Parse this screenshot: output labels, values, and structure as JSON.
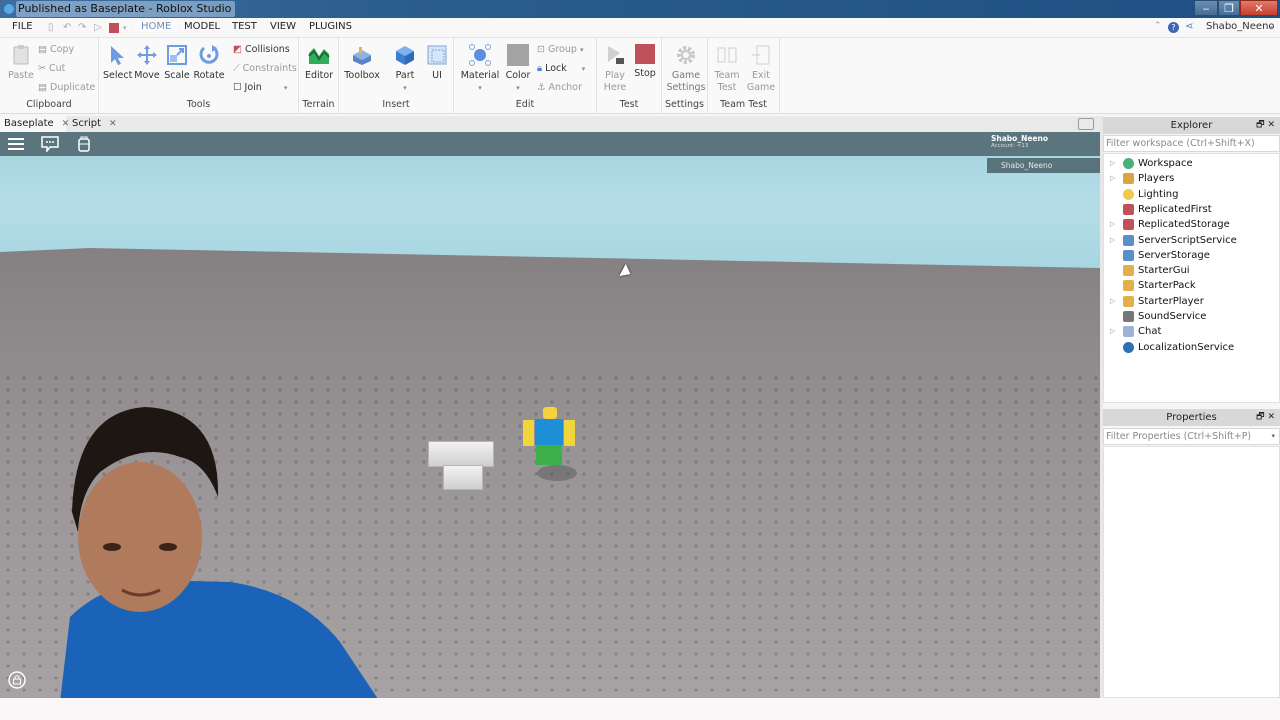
{
  "window": {
    "title": "Published as Baseplate - Roblox Studio",
    "controls": {
      "minimize": "‒",
      "maximize": "❐",
      "close": "✕"
    }
  },
  "menu": {
    "file": "FILE",
    "tabs": [
      "HOME",
      "MODEL",
      "TEST",
      "VIEW",
      "PLUGINS"
    ],
    "active_tab": "HOME",
    "username": "Shabo_Neeno",
    "user_dropdown": "▾"
  },
  "ribbon": {
    "clipboard": {
      "label": "Clipboard",
      "paste": "Paste",
      "copy": "Copy",
      "cut": "Cut",
      "duplicate": "Duplicate"
    },
    "tools": {
      "label": "Tools",
      "select": "Select",
      "move": "Move",
      "scale": "Scale",
      "rotate": "Rotate",
      "collisions": "Collisions",
      "constraints": "Constraints",
      "join": "Join"
    },
    "terrain": {
      "label": "Terrain",
      "editor": "Editor"
    },
    "insert": {
      "label": "Insert",
      "toolbox": "Toolbox",
      "part": "Part",
      "ui": "UI"
    },
    "edit": {
      "label": "Edit",
      "material": "Material",
      "color": "Color",
      "group": "Group",
      "lock": "Lock",
      "anchor": "Anchor"
    },
    "test": {
      "label": "Test",
      "play_here_1": "Play",
      "play_here_2": "Here",
      "stop": "Stop"
    },
    "settings": {
      "label": "Settings",
      "game_settings_1": "Game",
      "game_settings_2": "Settings"
    },
    "team_test": {
      "label": "Team Test",
      "team_test_1": "Team",
      "team_test_2": "Test",
      "exit_game_1": "Exit",
      "exit_game_2": "Game"
    }
  },
  "doc_tabs": [
    {
      "label": "Baseplate",
      "active": true
    },
    {
      "label": "Script",
      "active": false
    }
  ],
  "viewport": {
    "player_list": {
      "name": "Shabo_Neeno",
      "account": "Account: <13",
      "entry": "Shabo_Neeno"
    },
    "colors": {
      "sky": "#a5d3e0",
      "baseplate": "#8a8688",
      "hud_bar": "#506870"
    }
  },
  "explorer": {
    "title": "Explorer",
    "filter_placeholder": "Filter workspace (Ctrl+Shift+X)",
    "items": [
      {
        "label": "Workspace",
        "expandable": true,
        "icon": "globe-icon",
        "color": "#4caf7a"
      },
      {
        "label": "Players",
        "expandable": true,
        "icon": "players-icon",
        "color": "#d9a441"
      },
      {
        "label": "Lighting",
        "expandable": false,
        "icon": "lightbulb-icon",
        "color": "#f3c94a"
      },
      {
        "label": "ReplicatedFirst",
        "expandable": false,
        "icon": "replicated-first-icon",
        "color": "#c0505a"
      },
      {
        "label": "ReplicatedStorage",
        "expandable": true,
        "icon": "replicated-storage-icon",
        "color": "#c0505a"
      },
      {
        "label": "ServerScriptService",
        "expandable": true,
        "icon": "server-script-service-icon",
        "color": "#5a8fc7"
      },
      {
        "label": "ServerStorage",
        "expandable": false,
        "icon": "server-storage-icon",
        "color": "#5a8fc7"
      },
      {
        "label": "StarterGui",
        "expandable": false,
        "icon": "starter-gui-icon",
        "color": "#e2b04a"
      },
      {
        "label": "StarterPack",
        "expandable": false,
        "icon": "starter-pack-icon",
        "color": "#e2b04a"
      },
      {
        "label": "StarterPlayer",
        "expandable": true,
        "icon": "starter-player-icon",
        "color": "#e2b04a"
      },
      {
        "label": "SoundService",
        "expandable": false,
        "icon": "speaker-icon",
        "color": "#777777"
      },
      {
        "label": "Chat",
        "expandable": true,
        "icon": "chat-icon",
        "color": "#9ab3d6"
      },
      {
        "label": "LocalizationService",
        "expandable": false,
        "icon": "localization-icon",
        "color": "#2f6fb5"
      }
    ]
  },
  "properties": {
    "title": "Properties",
    "filter_placeholder": "Filter Properties (Ctrl+Shift+P)"
  },
  "panel_buttons": {
    "float": "🗗",
    "close": "✕"
  }
}
